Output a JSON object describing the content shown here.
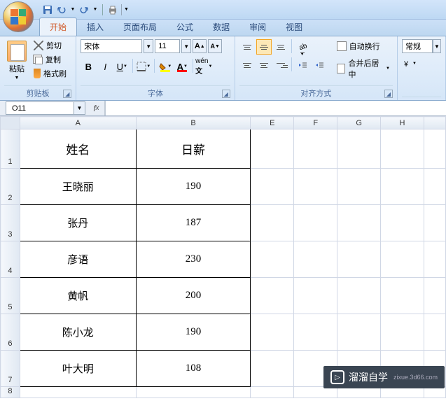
{
  "qat": {
    "save": "保存",
    "undo": "撤销",
    "redo": "重做"
  },
  "tabs": [
    "开始",
    "插入",
    "页面布局",
    "公式",
    "数据",
    "审阅",
    "视图"
  ],
  "active_tab": 0,
  "clipboard": {
    "paste": "粘贴",
    "cut": "剪切",
    "copy": "复制",
    "format_painter": "格式刷",
    "group_label": "剪贴板"
  },
  "font": {
    "name": "宋体",
    "size": "11",
    "group_label": "字体"
  },
  "alignment": {
    "wrap": "自动换行",
    "merge": "合并后居中",
    "group_label": "对齐方式"
  },
  "number": {
    "format": "常规"
  },
  "namebox": "O11",
  "formula": "",
  "cols": [
    "A",
    "B",
    "E",
    "F",
    "G",
    "H"
  ],
  "rows": [
    "1",
    "2",
    "3",
    "4",
    "5",
    "6",
    "7",
    "8"
  ],
  "table": {
    "headers": [
      "姓名",
      "日薪"
    ],
    "rows": [
      [
        "王晓丽",
        "190"
      ],
      [
        "张丹",
        "187"
      ],
      [
        "彦语",
        "230"
      ],
      [
        "黄帆",
        "200"
      ],
      [
        "陈小龙",
        "190"
      ],
      [
        "叶大明",
        "108"
      ]
    ]
  },
  "watermark": {
    "brand": "溜溜自学",
    "url": "zixue.3d66.com"
  }
}
